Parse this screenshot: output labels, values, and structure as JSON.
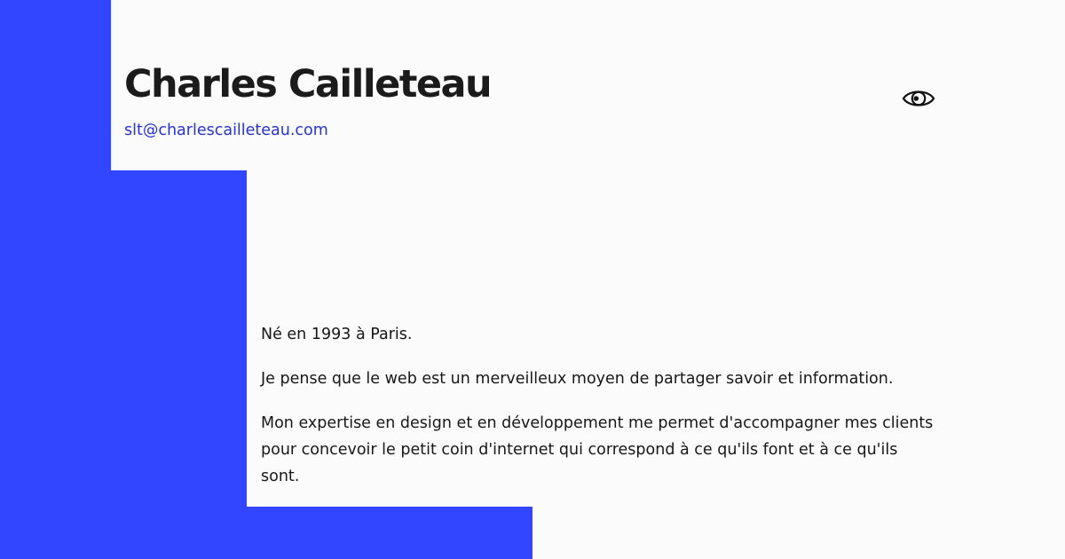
{
  "profile": {
    "name": "Charles Cailleteau",
    "email": "slt@charlescailleteau.com"
  },
  "bio": {
    "paragraph_1": "Né en 1993 à Paris.",
    "paragraph_2": "Je pense que le web est un merveilleux moyen de partager savoir et information.",
    "paragraph_3": "Mon expertise en design et en développement me permet d'accompagner mes clients pour concevoir le petit coin d'internet qui correspond à ce qu'ils font et à ce qu'ils sont."
  },
  "icons": {
    "visibility": "eye-icon"
  },
  "colors": {
    "accent": "#3346ff",
    "link": "#2533d8",
    "background": "#fbfbfb",
    "text": "#171717"
  }
}
